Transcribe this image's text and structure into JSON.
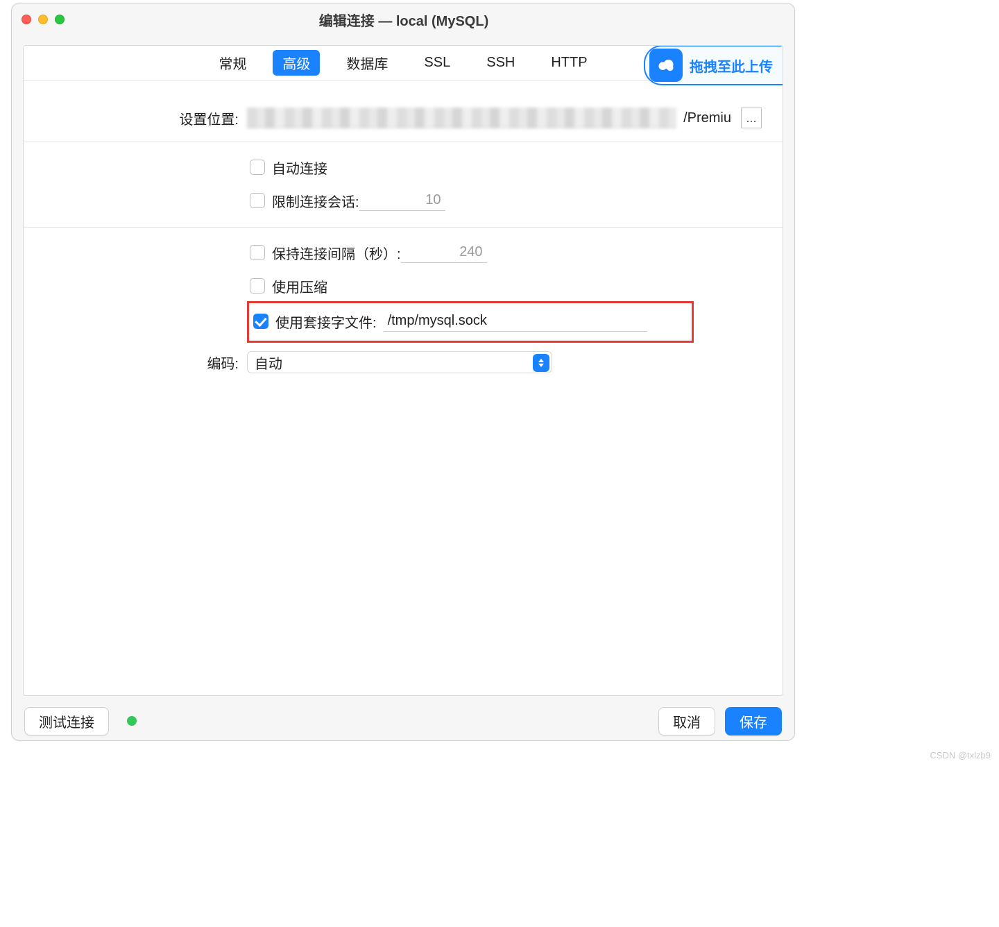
{
  "window": {
    "title": "编辑连接 — local (MySQL)"
  },
  "tabs": {
    "items": [
      "常规",
      "高级",
      "数据库",
      "SSL",
      "SSH",
      "HTTP"
    ],
    "activeIndex": 1
  },
  "upload": {
    "label": "拖拽至此上传"
  },
  "form": {
    "location_label": "设置位置:",
    "location_trail": "/Premiu",
    "ellipsis": "...",
    "auto_connect": {
      "label": "自动连接",
      "checked": false
    },
    "limit_sessions": {
      "label": "限制连接会话:",
      "checked": false,
      "value": "10"
    },
    "keepalive": {
      "label": "保持连接间隔（秒）:",
      "checked": false,
      "value": "240"
    },
    "compression": {
      "label": "使用压缩",
      "checked": false
    },
    "socket": {
      "label": "使用套接字文件:",
      "checked": true,
      "value": "/tmp/mysql.sock"
    },
    "encoding_label": "编码:",
    "encoding_value": "自动"
  },
  "footer": {
    "test": "测试连接",
    "cancel": "取消",
    "save": "保存"
  },
  "watermark": "CSDN @txlzb9"
}
